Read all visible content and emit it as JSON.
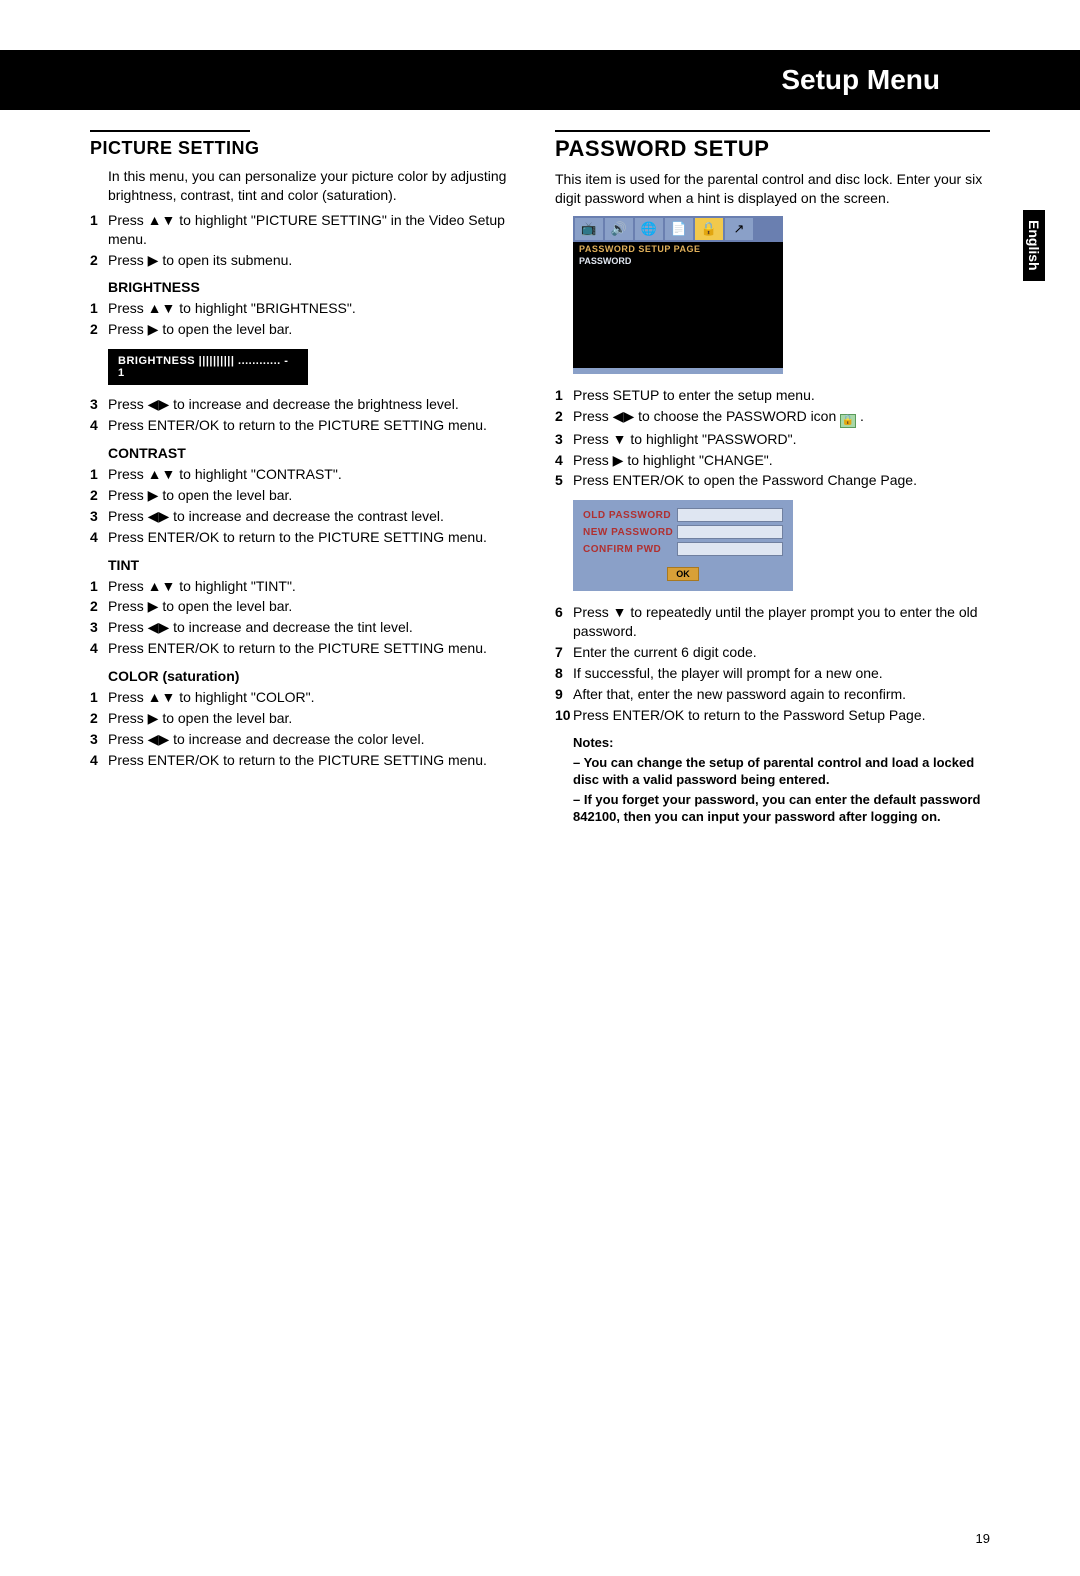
{
  "header": {
    "title": "Setup Menu"
  },
  "side_tab": "English",
  "page_number": "19",
  "left": {
    "heading": "PICTURE SETTING",
    "intro": "In this menu, you can personalize your picture color by adjusting brightness, contrast, tint and color (saturation).",
    "steps_top": [
      "Press ▲▼ to highlight \"PICTURE SETTING\" in the Video Setup menu.",
      "Press ▶ to open its submenu."
    ],
    "brightness": {
      "h": "BRIGHTNESS",
      "steps_a": [
        "Press ▲▼ to highlight \"BRIGHTNESS\".",
        "Press ▶ to open the level bar."
      ],
      "bar_label": "BRIGHTNESS |||||||||| ............   - 1",
      "steps_b": [
        "Press ◀▶ to increase and decrease the brightness level.",
        "Press ENTER/OK to return to the PICTURE SETTING menu."
      ]
    },
    "contrast": {
      "h": "CONTRAST",
      "steps": [
        "Press ▲▼ to highlight \"CONTRAST\".",
        "Press ▶ to open the level bar.",
        "Press ◀▶ to increase and decrease the contrast level.",
        "Press ENTER/OK to return to the PICTURE SETTING menu."
      ]
    },
    "tint": {
      "h": "TINT",
      "steps": [
        "Press ▲▼ to highlight \"TINT\".",
        "Press ▶ to open the level bar.",
        "Press ◀▶ to increase and decrease the tint level.",
        "Press ENTER/OK to return to the PICTURE SETTING menu."
      ]
    },
    "color": {
      "h": "COLOR (saturation)",
      "steps": [
        "Press ▲▼ to highlight \"COLOR\".",
        "Press ▶ to open the level bar.",
        "Press ◀▶ to increase and decrease the color level.",
        "Press ENTER/OK to return to the PICTURE SETTING menu."
      ]
    }
  },
  "right": {
    "heading": "PASSWORD SETUP",
    "intro": "This item is used for the parental control and disc lock. Enter your six digit password when a hint is displayed on the screen.",
    "osd": {
      "title": "PASSWORD  SETUP  PAGE",
      "row": "PASSWORD",
      "icons": [
        "tv",
        "speaker",
        "globe",
        "list",
        "lock",
        "exit"
      ]
    },
    "steps_a": [
      "Press SETUP to enter the setup menu.",
      "Press ◀▶ to choose the PASSWORD icon",
      "Press ▼ to highlight \"PASSWORD\".",
      "Press ▶ to highlight \"CHANGE\".",
      "Press ENTER/OK to open the Password Change Page."
    ],
    "dialog": {
      "old": "OLD  PASSWORD",
      "new": "NEW  PASSWORD",
      "confirm": "CONFIRM  PWD",
      "ok": "OK"
    },
    "steps_b": [
      "Press ▼ to repeatedly until the player prompt you to enter the old password.",
      "Enter the current 6 digit code.",
      "If successful, the player will prompt for a new one.",
      "After that, enter the new password again to reconfirm.",
      "Press ENTER/OK to return to the Password Setup Page."
    ],
    "notes_h": "Notes:",
    "notes": [
      "– You can change the setup of parental control and load a locked disc with a valid password being entered.",
      "– If you forget your password, you can enter the default password 842100, then you can input your password after logging on."
    ]
  }
}
